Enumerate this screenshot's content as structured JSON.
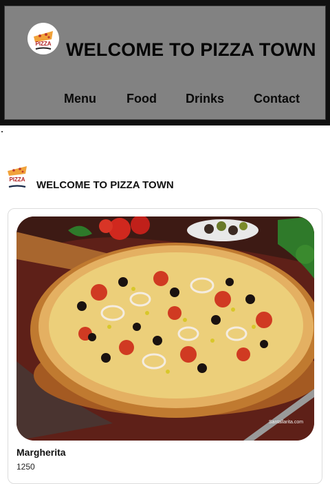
{
  "header": {
    "title": "WELCOME TO PIZZA TOWN",
    "logo_text": "PIZZA",
    "nav": [
      {
        "label": "Menu"
      },
      {
        "label": "Food"
      },
      {
        "label": "Drinks"
      },
      {
        "label": "Contact"
      }
    ]
  },
  "brand": {
    "title": "WELCOME TO PIZZA TOWN",
    "logo_text": "PIZZA"
  },
  "card": {
    "name": "Margherita",
    "price": "1250",
    "image_watermark": "Santallarita.com"
  },
  "colors": {
    "header_bg": "#828282",
    "header_border": "#101010",
    "logo_red": "#c0392b"
  }
}
